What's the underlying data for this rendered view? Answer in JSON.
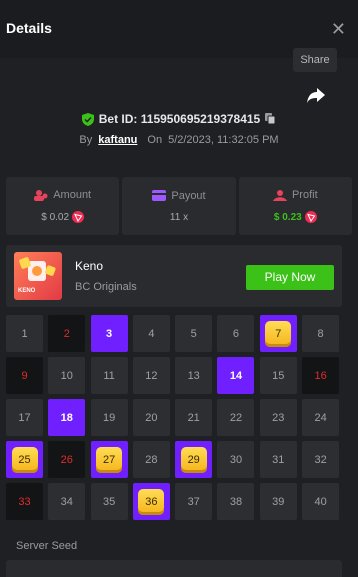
{
  "header": {
    "title": "Details",
    "close_icon": "close-icon"
  },
  "share": {
    "label": "Share",
    "icon": "share-arrow-icon"
  },
  "bet": {
    "id_text": "Bet ID: 115950695219378415",
    "by_label": "By",
    "user": "kaftanu",
    "on_label": "On",
    "datetime": "5/2/2023, 11:32:05 PM"
  },
  "stats": {
    "amount": {
      "label": "Amount",
      "value": "$ 0.02"
    },
    "payout": {
      "label": "Payout",
      "value": "11 x"
    },
    "profit": {
      "label": "Profit",
      "value": "$ 0.23"
    }
  },
  "game": {
    "thumb_text": "KENO",
    "name": "Keno",
    "provider": "BC Originals",
    "play_label": "Play Now"
  },
  "grid": {
    "numbers": [
      "1",
      "2",
      "3",
      "4",
      "5",
      "6",
      "7",
      "8",
      "9",
      "10",
      "11",
      "12",
      "13",
      "14",
      "15",
      "16",
      "17",
      "18",
      "19",
      "20",
      "21",
      "22",
      "23",
      "24",
      "25",
      "26",
      "27",
      "28",
      "29",
      "30",
      "31",
      "32",
      "33",
      "34",
      "35",
      "36",
      "37",
      "38",
      "39",
      "40"
    ],
    "picked": [
      3,
      14,
      18
    ],
    "hits": [
      7,
      25,
      27,
      29,
      36
    ],
    "dark": [
      2,
      9,
      16,
      18,
      26,
      33
    ]
  },
  "server_seed": {
    "label": "Server Seed"
  },
  "colors": {
    "accent": "#7020ff",
    "green": "#3bc117",
    "red": "#e02b2b",
    "gold": "#f4b31a"
  }
}
